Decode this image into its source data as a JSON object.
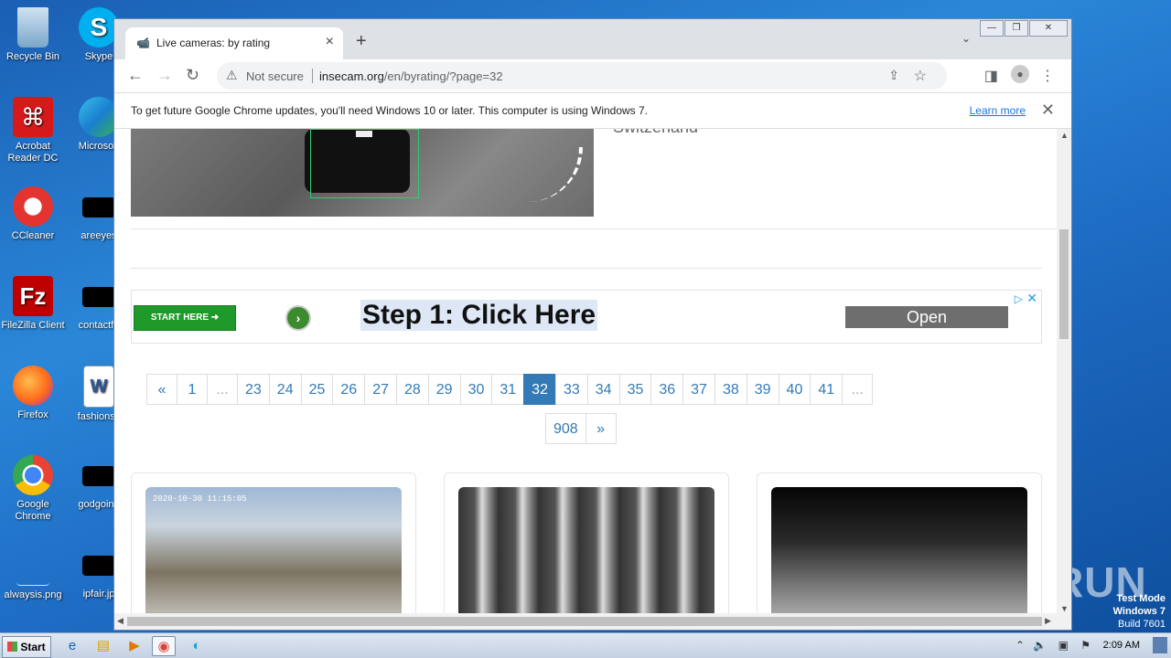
{
  "desktop": {
    "icons": [
      {
        "label": "Recycle Bin"
      },
      {
        "label": "Skype"
      },
      {
        "label": "Acrobat Reader DC"
      },
      {
        "label": "Microsoft"
      },
      {
        "label": "CCleaner"
      },
      {
        "label": "areeyes"
      },
      {
        "label": "FileZilla Client"
      },
      {
        "label": "contactfri"
      },
      {
        "label": "Firefox"
      },
      {
        "label": "fashionsy"
      },
      {
        "label": "Google Chrome"
      },
      {
        "label": "godgoing"
      },
      {
        "label": "alwaysis.png"
      },
      {
        "label": "ipfair.jp"
      }
    ],
    "watermark": "ANY RUN",
    "test_mode": {
      "line1": "Test Mode",
      "line2": "Windows 7",
      "line3": "Build 7601"
    }
  },
  "browser": {
    "tab": {
      "title": "Live cameras: by rating",
      "close": "×"
    },
    "new_tab": "+",
    "window_buttons": {
      "minimize": "—",
      "restore": "❐",
      "close": "✕"
    },
    "address": {
      "security": "Not secure",
      "host": "insecam.org",
      "path": "/en/byrating/?page=32"
    },
    "infobar": {
      "message": "To get future Google Chrome updates, you'll need Windows 10 or later. This computer is using Windows 7.",
      "link": "Learn more"
    }
  },
  "page": {
    "top_caption": "Switzerland",
    "ad": {
      "start_label": "START HERE ➜",
      "headline": "Step 1: Click Here",
      "open_label": "Open"
    },
    "pagination_row1": [
      "«",
      "1",
      "...",
      "23",
      "24",
      "25",
      "26",
      "27",
      "28",
      "29",
      "30",
      "31",
      "32",
      "33",
      "34",
      "35",
      "36",
      "37",
      "38",
      "39",
      "40",
      "41",
      "..."
    ],
    "pagination_row2": [
      "908",
      "»"
    ],
    "active_page": "32",
    "cameras": [
      {
        "timestamp": "2020-10-30 11:15:05"
      },
      {
        "timestamp": ""
      },
      {
        "timestamp": ""
      }
    ]
  },
  "taskbar": {
    "start_label": "Start",
    "clock": "2:09 AM"
  }
}
